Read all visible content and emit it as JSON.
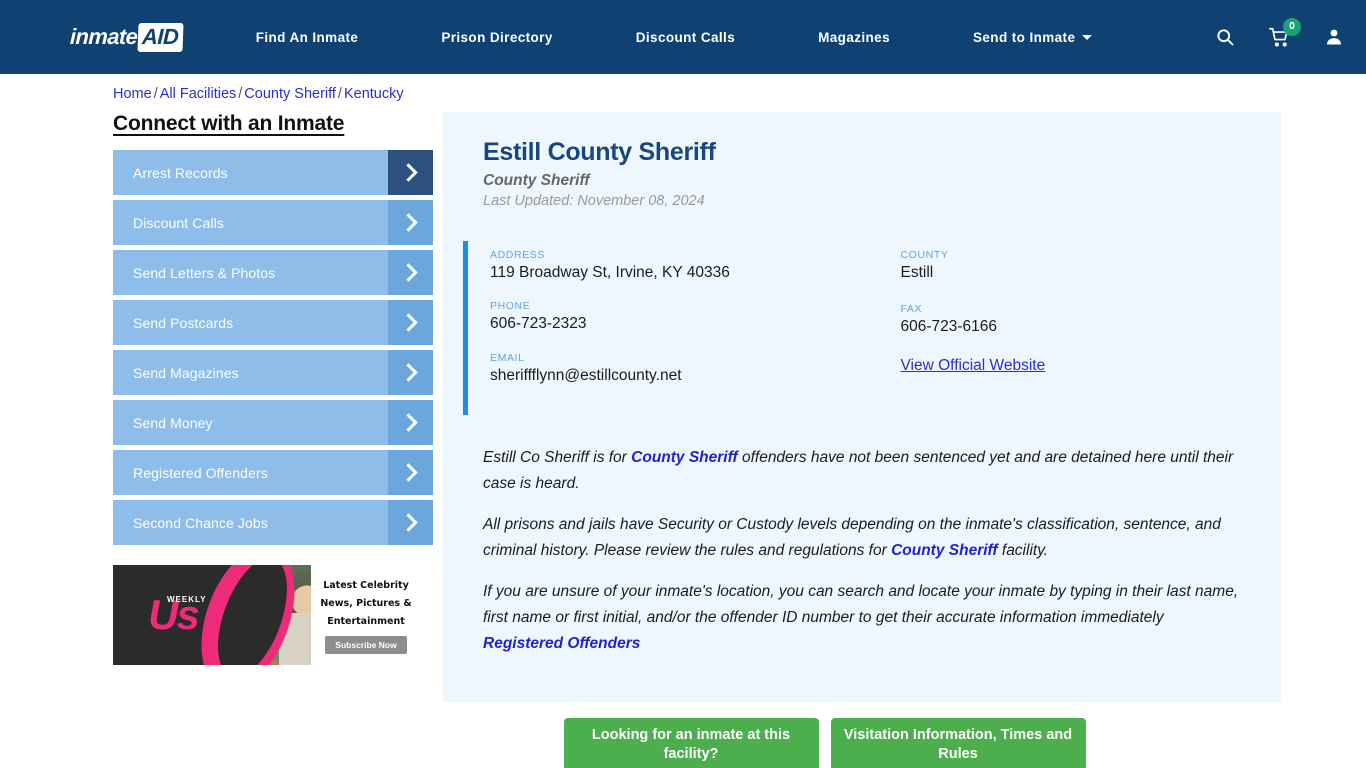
{
  "header": {
    "logo": {
      "word": "inmate",
      "aid": "AID",
      "plus_icon": "green-plus-icon"
    },
    "nav": [
      {
        "label": "Find An Inmate"
      },
      {
        "label": "Prison Directory"
      },
      {
        "label": "Discount Calls"
      },
      {
        "label": "Magazines"
      },
      {
        "label": "Send to Inmate",
        "dropdown": true
      }
    ],
    "icons": {
      "search": "search-icon",
      "cart": "cart-icon",
      "cart_count": "0",
      "account": "account-icon"
    },
    "bg_color": "#0f4272",
    "badge_color": "#17a673"
  },
  "breadcrumb": {
    "items": [
      "Home",
      "All Facilities",
      "County Sheriff",
      "Kentucky"
    ],
    "separator": "/"
  },
  "sidebar": {
    "title": "Connect with an Inmate",
    "items": [
      {
        "label": "Arrest Records",
        "active": true
      },
      {
        "label": "Discount Calls",
        "active": false
      },
      {
        "label": "Send Letters & Photos",
        "active": false
      },
      {
        "label": "Send Postcards",
        "active": false
      },
      {
        "label": "Send Magazines",
        "active": false
      },
      {
        "label": "Send Money",
        "active": false
      },
      {
        "label": "Registered Offenders",
        "active": false
      },
      {
        "label": "Second Chance Jobs",
        "active": false
      }
    ],
    "ad": {
      "brand": "Us",
      "brand_sub": "WEEKLY",
      "text": "Latest Celebrity News, Pictures & Entertainment",
      "cta": "Subscribe Now"
    }
  },
  "facility": {
    "name": "Estill County Sheriff",
    "type": "County Sheriff",
    "last_updated": "Last Updated: November 08, 2024",
    "contact": {
      "address_label": "ADDRESS",
      "address_value": "119 Broadway St, Irvine, KY 40336",
      "county_label": "COUNTY",
      "county_value": "Estill",
      "phone_label": "PHONE",
      "phone_value": "606-723-2323",
      "fax_label": "FAX",
      "fax_value": "606-723-6166",
      "email_label": "EMAIL",
      "email_value": "sheriffflynn@estillcounty.net",
      "website_link": "View Official Website"
    },
    "description": {
      "p1_a": "Estill Co Sheriff is for ",
      "p1_link": "County Sheriff",
      "p1_b": " offenders have not been sentenced yet and are detained here until their case is heard.",
      "p2_a": "All prisons and jails have Security or Custody levels depending on the inmate's classification, sentence, and criminal history. Please review the rules and regulations for ",
      "p2_link": "County Sheriff",
      "p2_b": " facility.",
      "p3_a": "If you are unsure of your inmate's location, you can search and locate your inmate by typing in their last name, first name or first initial, and/or the offender ID number to get their accurate information immediately ",
      "p3_link": "Registered Offenders"
    }
  },
  "cta": {
    "primary": "Looking for an inmate at this facility?",
    "secondary": "Visitation Information, Times and Rules",
    "color": "#4cae4c"
  }
}
